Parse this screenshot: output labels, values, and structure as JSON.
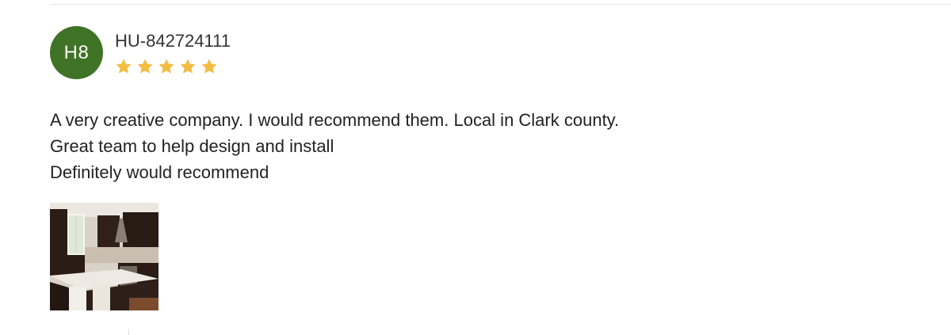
{
  "review": {
    "avatar_initials": "H8",
    "avatar_color": "#3f7326",
    "reviewer_name": "HU-842724111",
    "rating": 5,
    "rating_max": 5,
    "star_color": "#f4bc43",
    "text_lines": [
      "A very creative company. I would recommend them. Local in Clark county.",
      "Great team to help design and install",
      "Definitely would recommend"
    ],
    "photo_icon": "kitchen-photo"
  }
}
